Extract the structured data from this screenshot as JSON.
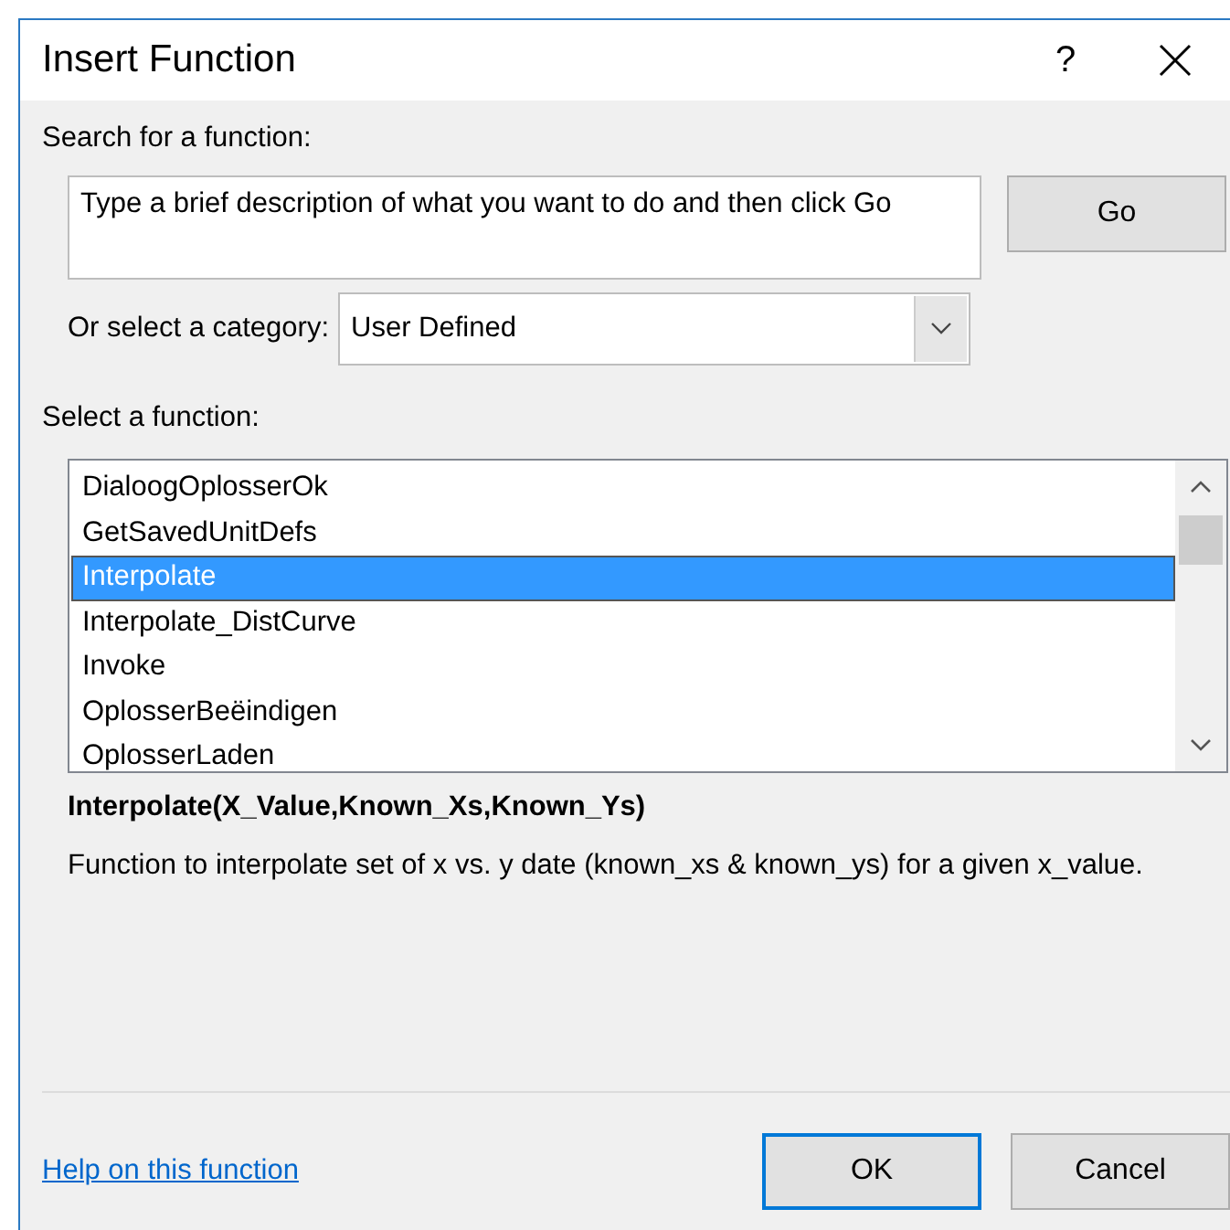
{
  "window": {
    "title": "Insert Function",
    "help_glyph": "?"
  },
  "search": {
    "label": "Search for a function:",
    "placeholder": "Type a brief description of what you want to do and then click Go",
    "button": "Go"
  },
  "category": {
    "label": "Or select a category:",
    "value": "User Defined"
  },
  "functions": {
    "label": "Select a function:",
    "items": [
      {
        "name": "DialoogOplosserOk",
        "selected": false
      },
      {
        "name": "GetSavedUnitDefs",
        "selected": false
      },
      {
        "name": "Interpolate",
        "selected": true
      },
      {
        "name": "Interpolate_DistCurve",
        "selected": false
      },
      {
        "name": "Invoke",
        "selected": false
      },
      {
        "name": "OplosserBeëindigen",
        "selected": false
      },
      {
        "name": "OplosserLaden",
        "selected": false
      }
    ]
  },
  "signature": "Interpolate(X_Value,Known_Xs,Known_Ys)",
  "description": "Function to interpolate set of x vs. y date (known_xs & known_ys) for a given x_value.",
  "help_link": "Help on this function",
  "buttons": [
    {
      "label": "OK",
      "kind": "default"
    },
    {
      "label": "Cancel",
      "kind": "normal"
    }
  ]
}
